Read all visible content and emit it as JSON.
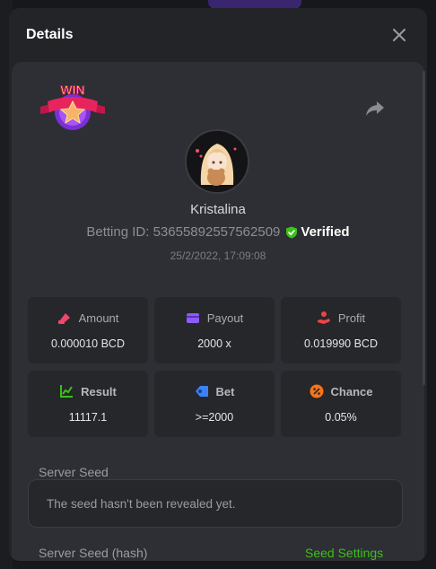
{
  "modal": {
    "title": "Details"
  },
  "player": {
    "username": "Kristalina",
    "betting_id_label": "Betting ID: 53655892557562509",
    "verified_label": "Verified",
    "timestamp": "25/2/2022, 17:09:08"
  },
  "badge": {
    "text": "WIN"
  },
  "stats": [
    {
      "label": "Amount",
      "value": "0.000010 BCD",
      "icon": "amount-icon",
      "color": "#f0466b"
    },
    {
      "label": "Payout",
      "value": "2000 x",
      "icon": "wallet-icon",
      "color": "#8b5cf6"
    },
    {
      "label": "Profit",
      "value": "0.019990 BCD",
      "icon": "profit-hand-icon",
      "color": "#ef4444"
    },
    {
      "label": "Result",
      "value": "11117.1",
      "icon": "result-chart-icon",
      "color": "#3bc117"
    },
    {
      "label": "Bet",
      "value": ">=2000",
      "icon": "bet-tag-icon",
      "color": "#3b82f6"
    },
    {
      "label": "Chance",
      "value": "0.05%",
      "icon": "percent-icon",
      "color": "#f97316"
    }
  ],
  "server_seed": {
    "label": "Server Seed",
    "box_text": "The seed hasn't been revealed yet.",
    "hash_label": "Server Seed (hash)",
    "settings_link": "Seed Settings"
  },
  "colors": {
    "accent_green": "#3bc117",
    "modal_bg": "#232428",
    "card_bg": "#2d2f34"
  }
}
